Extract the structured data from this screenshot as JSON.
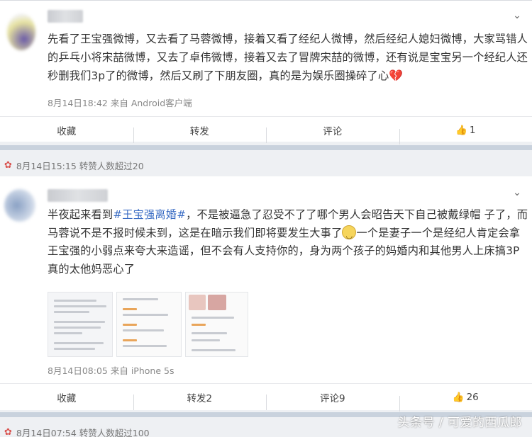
{
  "post1": {
    "text": "先看了王宝强微博，又去看了马蓉微博，接着又看了经纪人微博，然后经纪人媳妇微博，大家骂错人的乒乓小将宋喆微博，又去了卓伟微博，接着又去了冒牌宋喆的微博，还有说是宝宝另一个经纪人还秒删我们3p了的微博，然后又刷了下朋友圈，真的是为娱乐圈操碎了心",
    "meta": "8月14日18:42 来自 Android客户端",
    "actions": {
      "collect": "收藏",
      "repost": "转发",
      "comment": "评论",
      "like_count": "1"
    }
  },
  "repost_bar1": {
    "text": "8月14日15:15   转赞人数超过20"
  },
  "post2": {
    "prefix": "半夜起来看到",
    "topic": "#王宝强离婚#",
    "text_a": "，不是被逼急了忍受不了了哪个男人会昭告天下自己被戴绿帽 子了，而马蓉说不是不报时候未到，这是在暗示我们即将要发生大事了",
    "text_b": "一个是妻子一个是经纪人肯定会拿王宝强的小弱点来夸大来造谣，但不会有人支持你的，身为两个孩子的妈婚内和其他男人上床搞3P真的太他妈恶心了",
    "meta": "8月14日08:05 来自 iPhone 5s",
    "actions": {
      "collect": "收藏",
      "repost": "转发2",
      "comment": "评论9",
      "like_count": "26"
    }
  },
  "repost_bar2": {
    "text": "8月14日07:54   转赞人数超过100"
  },
  "watermark": "头条号 / 可爱的西瓜郎",
  "icons": {
    "chevron": "chevron-down-icon",
    "like": "thumbs-up-icon",
    "broken_heart": "broken-heart-icon",
    "smile": "smile-emoji-icon",
    "repost_marker": "repost-marker-icon"
  }
}
